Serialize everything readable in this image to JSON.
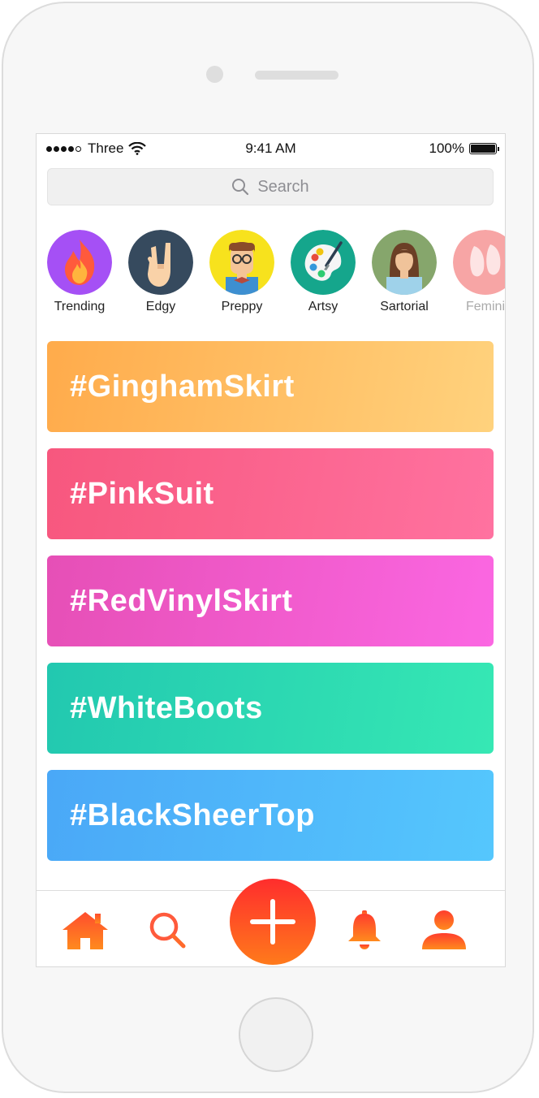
{
  "status_bar": {
    "carrier": "Three",
    "time": "9:41 AM",
    "battery": "100%"
  },
  "search": {
    "placeholder": "Search",
    "icon": "search-icon"
  },
  "categories": [
    {
      "label": "Trending",
      "icon": "flame-icon",
      "color": "#a550f5"
    },
    {
      "label": "Edgy",
      "icon": "rock-hand-icon",
      "color": "#364a5e"
    },
    {
      "label": "Preppy",
      "icon": "preppy-person-icon",
      "color": "#f7e21d"
    },
    {
      "label": "Artsy",
      "icon": "paint-palette-icon",
      "color": "#15a68c"
    },
    {
      "label": "Sartorial",
      "icon": "woman-avatar-icon",
      "color": "#86a66c"
    },
    {
      "label": "Femini",
      "icon": "ballet-shoes-icon",
      "color": "#f7a5a5"
    }
  ],
  "tags": [
    {
      "label": "#GinghamSkirt"
    },
    {
      "label": "#PinkSuit"
    },
    {
      "label": "#RedVinylSkirt"
    },
    {
      "label": "#WhiteBoots"
    },
    {
      "label": "#BlackSheerTop"
    }
  ],
  "tab_bar": {
    "items": [
      "home-icon",
      "search-icon",
      "add-icon",
      "bell-icon",
      "profile-icon"
    ],
    "accent": "#ff5a1f"
  }
}
